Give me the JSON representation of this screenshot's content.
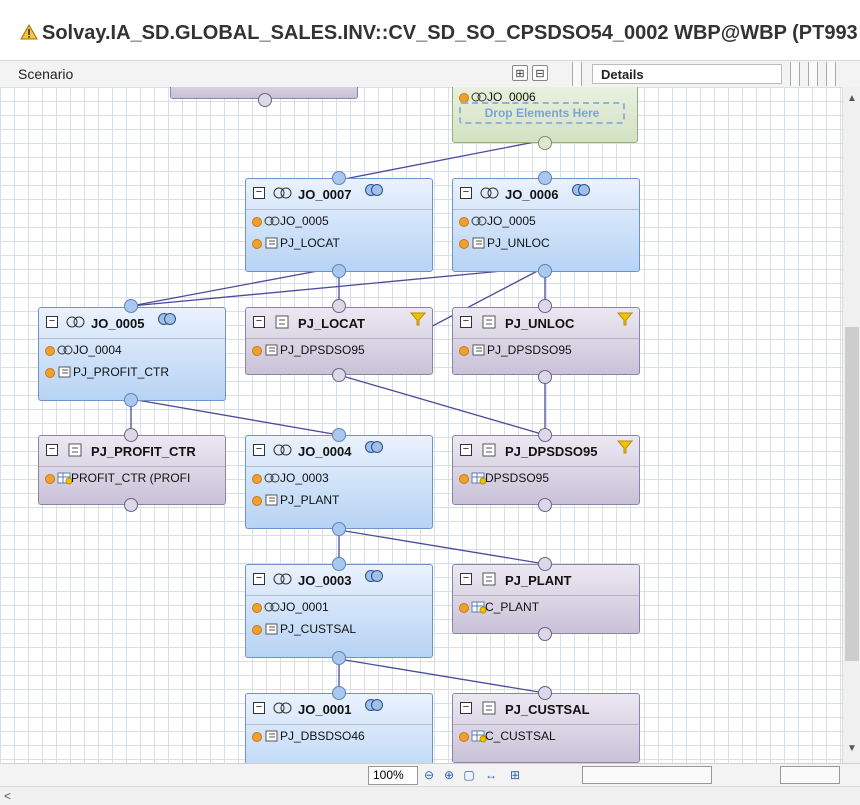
{
  "window": {
    "title": "Solvay.IA_SD.GLOBAL_SALES.INV::CV_SD_SO_CPSDSO54_0002 WBP@WBP (PT993"
  },
  "toolbar": {
    "scenario_label": "Scenario",
    "details_tab": "Details",
    "expand_all_icon": "expand-all-icon",
    "collapse_all_icon": "collapse-all-icon"
  },
  "canvas": {
    "drop_hint": "Drop Elements Here",
    "nodes": {
      "top_stub": {
        "name": ""
      },
      "top_join": {
        "name": "",
        "inputs": [
          "JO_0006"
        ]
      },
      "jo7": {
        "name": "JO_0007",
        "inputs": [
          "JO_0005",
          "PJ_LOCAT"
        ]
      },
      "jo6": {
        "name": "JO_0006",
        "inputs": [
          "JO_0005",
          "PJ_UNLOC"
        ]
      },
      "jo5": {
        "name": "JO_0005",
        "inputs": [
          "JO_0004",
          "PJ_PROFIT_CTR"
        ]
      },
      "pj_locat": {
        "name": "PJ_LOCAT",
        "inputs": [
          "PJ_DPSDSO95"
        ]
      },
      "pj_unloc": {
        "name": "PJ_UNLOC",
        "inputs": [
          "PJ_DPSDSO95"
        ]
      },
      "pj_profit": {
        "name": "PJ_PROFIT_CTR",
        "inputs": [
          "PROFIT_CTR (PROFI"
        ]
      },
      "jo4": {
        "name": "JO_0004",
        "inputs": [
          "JO_0003",
          "PJ_PLANT"
        ]
      },
      "pj_dps": {
        "name": "PJ_DPSDSO95",
        "inputs": [
          "DPSDSO95"
        ]
      },
      "jo3": {
        "name": "JO_0003",
        "inputs": [
          "JO_0001",
          "PJ_CUSTSAL"
        ]
      },
      "pj_plant": {
        "name": "PJ_PLANT",
        "inputs": [
          "C_PLANT"
        ]
      },
      "jo1": {
        "name": "JO_0001",
        "inputs": [
          "PJ_DBSDSO46"
        ]
      },
      "pj_custsal": {
        "name": "PJ_CUSTSAL",
        "inputs": [
          "C_CUSTSAL"
        ]
      }
    }
  },
  "zoom": {
    "value": "100%",
    "icons": [
      "zoom-out-icon",
      "zoom-in-icon",
      "fit-icon",
      "fit-width-icon",
      "layout-icon"
    ]
  },
  "colors": {
    "join_node": "#b7d3f5",
    "projection_node": "#c9c2d8",
    "aggregation_node": "#d3e2c2",
    "edge": "#4b4b9a",
    "port_dot": "#f0a030",
    "filter_icon": "#f2c200"
  }
}
